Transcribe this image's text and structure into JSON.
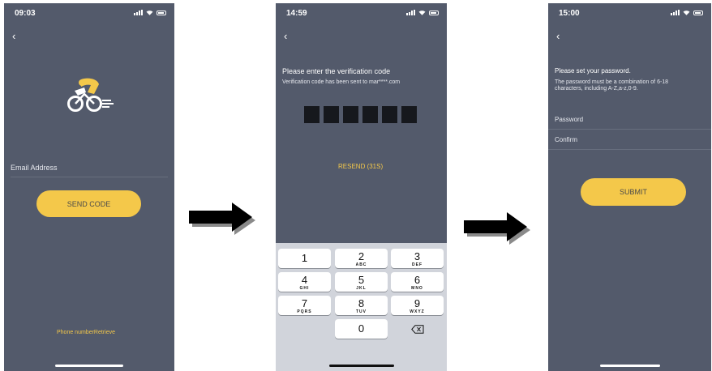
{
  "screen1": {
    "time": "09:03",
    "email_label": "Email Address",
    "send_button": "SEND CODE",
    "phone_link": "Phone numberRetrieve"
  },
  "screen2": {
    "time": "14:59",
    "title": "Please enter the verification code",
    "subtitle": "Verification code has been sent to mar****.com",
    "resend": "RESEND (31S)",
    "keys": [
      {
        "digit": "1",
        "letters": ""
      },
      {
        "digit": "2",
        "letters": "ABC"
      },
      {
        "digit": "3",
        "letters": "DEF"
      },
      {
        "digit": "4",
        "letters": "GHI"
      },
      {
        "digit": "5",
        "letters": "JKL"
      },
      {
        "digit": "6",
        "letters": "MNO"
      },
      {
        "digit": "7",
        "letters": "PQRS"
      },
      {
        "digit": "8",
        "letters": "TUV"
      },
      {
        "digit": "9",
        "letters": "WXYZ"
      },
      {
        "digit": "0",
        "letters": ""
      }
    ]
  },
  "screen3": {
    "time": "15:00",
    "title": "Please set your password.",
    "subtitle_line1": "The password must be a combination of 6-18",
    "subtitle_line2": "characters, including A-Z,a-z,0-9.",
    "password_label": "Password",
    "confirm_label": "Confirm",
    "submit_button": "SUBMIT"
  },
  "colors": {
    "background": "#535a6b",
    "accent": "#f4c84a",
    "code_box": "#16181d",
    "keypad": "#d1d4db"
  },
  "icons": {
    "back": "chevron-left-icon",
    "logo": "cyclist-logo-icon",
    "arrow": "right-arrow-icon",
    "delete": "backspace-icon"
  }
}
